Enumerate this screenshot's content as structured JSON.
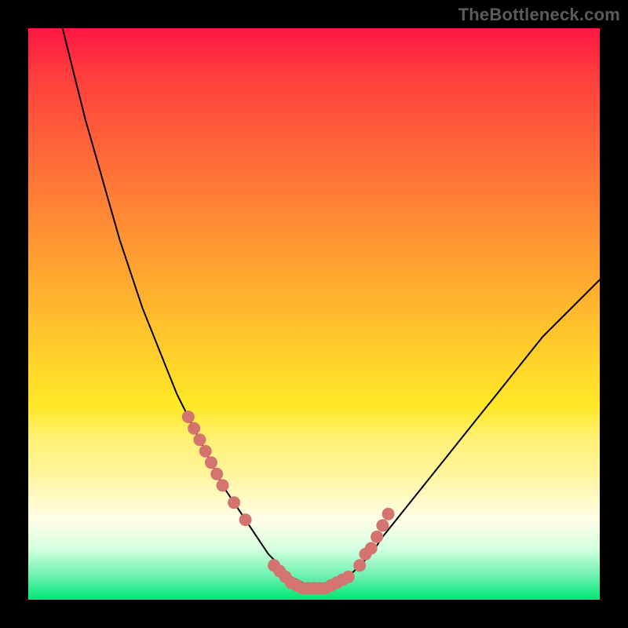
{
  "watermark": "TheBottleneck.com",
  "chart_data": {
    "type": "line",
    "title": "",
    "xlabel": "",
    "ylabel": "",
    "xlim": [
      0,
      100
    ],
    "ylim": [
      0,
      100
    ],
    "grid": false,
    "series": [
      {
        "name": "bottleneck-curve",
        "x": [
          6,
          8,
          10,
          12,
          14,
          16,
          18,
          20,
          22,
          24,
          26,
          28,
          30,
          32,
          34,
          36,
          38,
          40,
          42,
          44,
          46,
          48,
          50,
          52,
          54,
          56,
          58,
          60,
          62,
          66,
          70,
          74,
          78,
          82,
          86,
          90,
          94,
          98,
          100
        ],
        "y": [
          100,
          92,
          84,
          77,
          70,
          63,
          57,
          51,
          46,
          41,
          36,
          32,
          28,
          24,
          20,
          17,
          14,
          11,
          8,
          6,
          4,
          3,
          2,
          2,
          3,
          4,
          6,
          8,
          11,
          16,
          21,
          26,
          31,
          36,
          41,
          46,
          50,
          54,
          56
        ]
      }
    ],
    "marker_points": {
      "name": "highlighted-dots",
      "x": [
        28,
        29,
        30,
        31,
        32,
        33,
        34,
        36,
        38,
        43,
        44,
        45,
        46,
        47,
        48,
        49,
        50,
        51,
        52,
        53,
        54,
        55,
        56,
        58,
        59,
        60,
        61,
        62,
        63
      ],
      "y": [
        32,
        30,
        28,
        26,
        24,
        22,
        20,
        17,
        14,
        6,
        5,
        4,
        3,
        2.5,
        2,
        2,
        2,
        2,
        2,
        2.5,
        3,
        3.5,
        4,
        6,
        8,
        9,
        11,
        13,
        15
      ]
    },
    "colors": {
      "curve": "#000000",
      "dots": "#d4746f",
      "gradient_top": "#ff1744",
      "gradient_mid": "#ffd22a",
      "gradient_bottom": "#00e676"
    }
  }
}
